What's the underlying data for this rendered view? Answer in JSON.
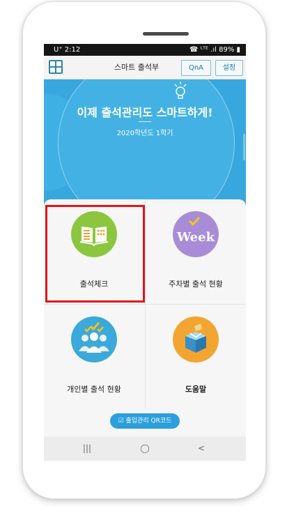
{
  "status_bar": {
    "carrier_time": "U⁺ 2:12",
    "right": "☎ ᴸᵀᴱ .ıl 89% ▮"
  },
  "app_bar": {
    "title": "스마트 출석부",
    "qna_label": "QnA",
    "settings_label": "설정"
  },
  "banner": {
    "headline": "이제 출석관리도 스마트하게!",
    "semester": "2020학년도 1학기"
  },
  "menu": [
    {
      "label": "출석체크",
      "icon": "book-icon",
      "color": "#8cc63f"
    },
    {
      "label": "주차별 출석 현황",
      "icon": "week-icon",
      "color": "#a98cd8",
      "icon_text": "Week"
    },
    {
      "label": "개인별 출석 현황",
      "icon": "people-check-icon",
      "color": "#3ba9d9"
    },
    {
      "label": "도움말",
      "icon": "help-box-icon",
      "color": "#f2a531"
    }
  ],
  "qr_button": {
    "label": "출입관리 QR코드"
  },
  "nav_bar": {
    "recent": "|||",
    "home": "◯",
    "back": "<"
  },
  "colors": {
    "banner": "#37a7de",
    "accent": "#2c86a4",
    "highlight": "#e3141b"
  }
}
